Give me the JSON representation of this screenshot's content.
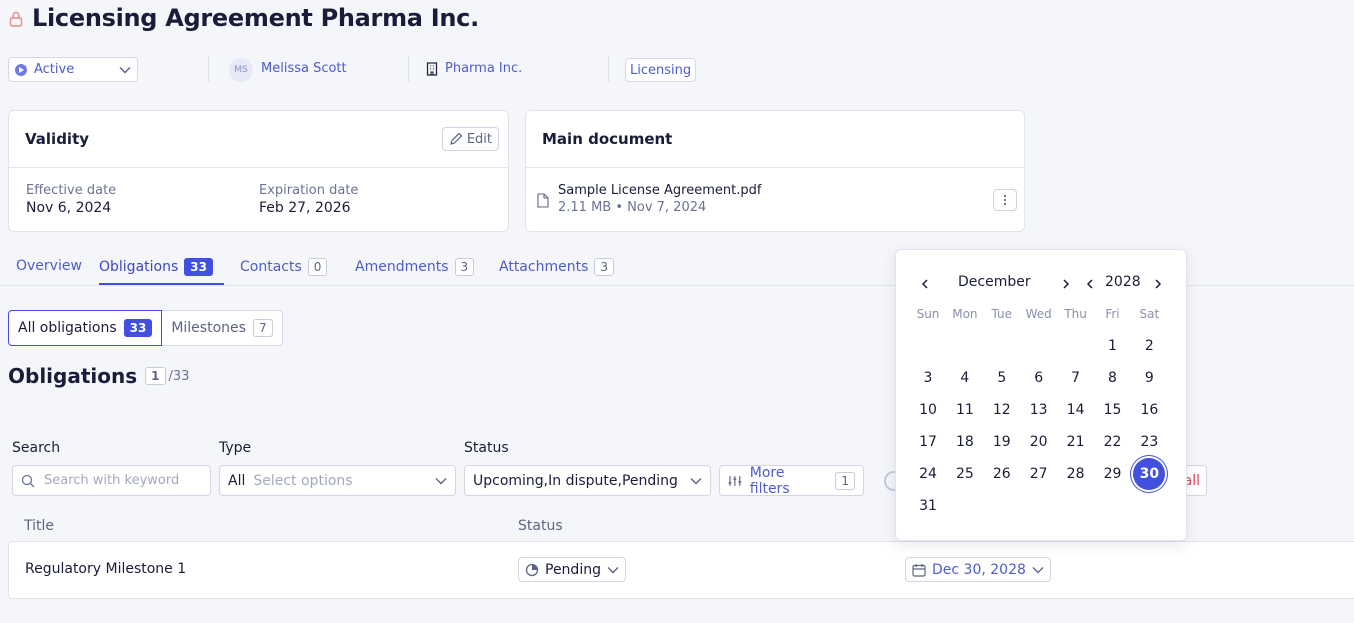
{
  "header": {
    "title": "Licensing Agreement Pharma Inc."
  },
  "meta": {
    "status": "Active",
    "owner_initials": "MS",
    "owner": "Melissa Scott",
    "company": "Pharma Inc.",
    "tag": "Licensing"
  },
  "validity": {
    "title": "Validity",
    "edit_label": "Edit",
    "effective_label": "Effective date",
    "effective_value": "Nov 6, 2024",
    "expiration_label": "Expiration date",
    "expiration_value": "Feb 27, 2026"
  },
  "main_document": {
    "title": "Main document",
    "file_name": "Sample License Agreement.pdf",
    "file_meta": "2.11 MB • Nov 7, 2024"
  },
  "tabs": [
    {
      "label": "Overview",
      "count": null
    },
    {
      "label": "Obligations",
      "count": "33"
    },
    {
      "label": "Contacts",
      "count": "0"
    },
    {
      "label": "Amendments",
      "count": "3"
    },
    {
      "label": "Attachments",
      "count": "3"
    }
  ],
  "segments": [
    {
      "label": "All obligations",
      "count": "33"
    },
    {
      "label": "Milestones",
      "count": "7"
    }
  ],
  "obligations": {
    "title": "Obligations",
    "shown": "1",
    "total": "/33"
  },
  "filters": {
    "search_label": "Search",
    "search_placeholder": "Search with keyword",
    "type_label": "Type",
    "type_value": "All",
    "type_placeholder": "Select options",
    "status_label": "Status",
    "status_value": "Upcoming,In dispute,Pending",
    "more_filters_label": "More filters",
    "more_filters_count": "1",
    "clear_all_fragment": "all"
  },
  "table": {
    "col_title": "Title",
    "col_status": "Status",
    "rows": [
      {
        "title": "Regulatory Milestone 1",
        "status": "Pending",
        "due": "Dec 30, 2028"
      }
    ]
  },
  "calendar": {
    "month": "December",
    "year": "2028",
    "weekdays": [
      "Sun",
      "Mon",
      "Tue",
      "Wed",
      "Thu",
      "Fri",
      "Sat"
    ],
    "first_weekday_index": 5,
    "days_in_month": 31,
    "selected_day": 30
  },
  "colors": {
    "accent": "#4250e0",
    "link": "#4d5cc9",
    "danger": "#e0475b"
  }
}
